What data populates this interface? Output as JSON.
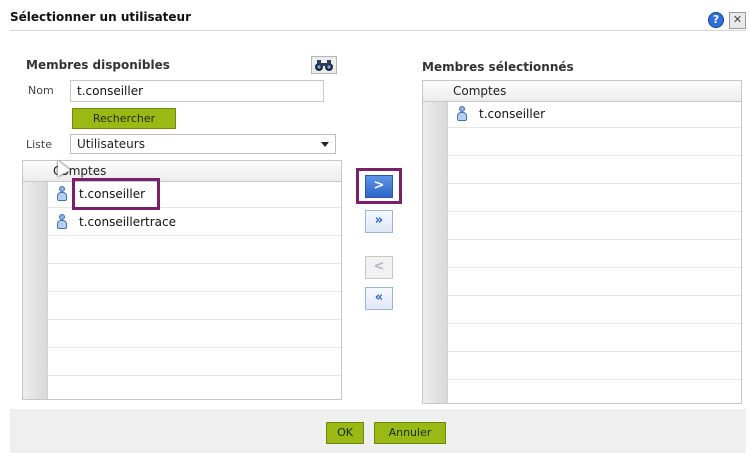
{
  "dialog": {
    "title": "Sélectionner un utilisateur",
    "help_glyph": "?",
    "close_glyph": "✕"
  },
  "available": {
    "title": "Membres disponibles",
    "name_label": "Nom",
    "name_value": "t.conseiller",
    "search_label": "Rechercher",
    "list_label": "Liste",
    "list_value": "Utilisateurs",
    "column_header": "Comptes",
    "rows": [
      {
        "label": "t.conseiller",
        "icon": "user-icon"
      },
      {
        "label": "t.conseillertrace",
        "icon": "user-icon"
      }
    ]
  },
  "transfer": {
    "add_glyph": ">",
    "add_all_glyph": "»",
    "remove_glyph": "<",
    "remove_all_glyph": "«"
  },
  "selected": {
    "title": "Membres sélectionnés",
    "column_header": "Comptes",
    "rows": [
      {
        "label": "t.conseiller",
        "icon": "user-icon"
      }
    ]
  },
  "footer": {
    "ok_label": "OK",
    "cancel_label": "Annuler"
  },
  "colors": {
    "accent_green": "#9ab915",
    "highlight_purple": "#7b1f6a",
    "button_blue": "#2e66c8"
  }
}
